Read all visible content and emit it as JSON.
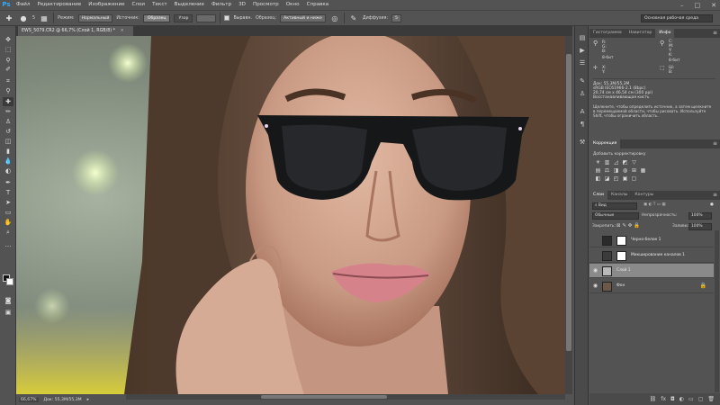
{
  "app": {
    "logo": "Ps"
  },
  "menu": [
    "Файл",
    "Редактирование",
    "Изображение",
    "Слои",
    "Текст",
    "Выделение",
    "Фильтр",
    "3D",
    "Просмотр",
    "Окно",
    "Справка"
  ],
  "window_controls": {
    "minimize": "–",
    "maximize": "□",
    "close": "✕"
  },
  "options": {
    "brush_size": "5",
    "mode_label": "Режим:",
    "mode_value": "Нормальный",
    "range_label": "Источник:",
    "range_source": "Образец",
    "range_pattern": "Узор",
    "aligned_label": "Выравн.",
    "sample_label": "Образец:",
    "sample_value": "Активный и ниже",
    "diffusion_label": "Диффузия:",
    "diffusion_value": "5",
    "workspace": "Основная рабочая среда"
  },
  "document": {
    "tab_title": "EWS_5079.CR2 @ 66,7% (Слой 1, RGB/8) *",
    "close": "×"
  },
  "status": {
    "zoom": "66,67%",
    "doc": "Док: 55,3М/55,3М",
    "arrow": "▸"
  },
  "top_panel": {
    "tabs": [
      "Гистограмма",
      "Навигатор",
      "Инфо"
    ],
    "active": 2,
    "rgb": {
      "r": "R:",
      "g": "G:",
      "b": "B:"
    },
    "cmyk": {
      "c": "C:",
      "m": "M:",
      "y": "Y:",
      "k": "K:"
    },
    "bits_a": "8-бит",
    "bits_b": "8-бит",
    "x": "X:",
    "y": "Y:",
    "w": "Ш:",
    "h": "В:",
    "doc_info": [
      "Док: 55,3М/55,3М",
      "sRGB IEC61966-2.1 (8bpc)",
      "20,74 см x 46,54 см (300 ppi)",
      "Восстанавливающая кисть"
    ],
    "hint": "Щелкните, чтобы определить источник, а затем щелкните в перемещаемой области, чтобы рисовать. Используйте Shift, чтобы ограничить область."
  },
  "corrections": {
    "tab": "Коррекция",
    "subtitle": "Добавить корректировку"
  },
  "layers_panel": {
    "tabs": [
      "Слои",
      "Каналы",
      "Контуры"
    ],
    "active": 0,
    "filter_label": "Вид",
    "blend_mode": "Обычные",
    "opacity_label": "Непрозрачность:",
    "opacity_value": "100%",
    "lock_label": "Закрепить:",
    "fill_label": "Заливка:",
    "fill_value": "100%",
    "layers": [
      {
        "name": "Черно-белое 1",
        "visible": false,
        "selected": false
      },
      {
        "name": "Микширование каналов 1",
        "visible": false,
        "selected": false
      },
      {
        "name": "Слой 1",
        "visible": true,
        "selected": true
      },
      {
        "name": "Фон",
        "visible": true,
        "selected": false
      }
    ],
    "footer_icons": [
      "link-icon",
      "fx-icon",
      "mask-icon",
      "adjustment-icon",
      "folder-icon",
      "new-layer-icon",
      "trash-icon"
    ]
  },
  "colors": {
    "accent": "#31a8ff",
    "bg": "#535353",
    "dark": "#3a3a3a"
  }
}
